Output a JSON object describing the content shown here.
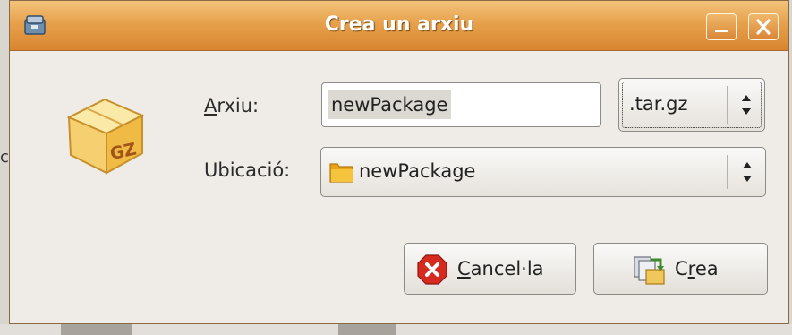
{
  "window": {
    "title": "Crea un arxiu"
  },
  "form": {
    "file_label_mnemonic": "A",
    "file_label_rest": "rxiu:",
    "file_value": "newPackage",
    "extension_value": ".tar.gz",
    "location_label": "Ubicació:",
    "location_value": "newPackage"
  },
  "buttons": {
    "cancel_mnemonic": "C",
    "cancel_rest": "ancel·la",
    "create_first": "C",
    "create_mnemonic": "r",
    "create_rest": "ea"
  },
  "background": {
    "left_char": "c"
  },
  "icons": {
    "app": "archive-manager-icon",
    "package": "gz-package-icon",
    "folder": "folder-icon",
    "cancel": "cancel-icon",
    "create": "create-archive-icon",
    "minimize": "minimize-icon",
    "close": "close-icon"
  },
  "colors": {
    "titlebar": "#e7a14b",
    "window_bg": "#efebe7",
    "cancel_red": "#d62a20",
    "folder_yellow": "#f1bd2c"
  }
}
